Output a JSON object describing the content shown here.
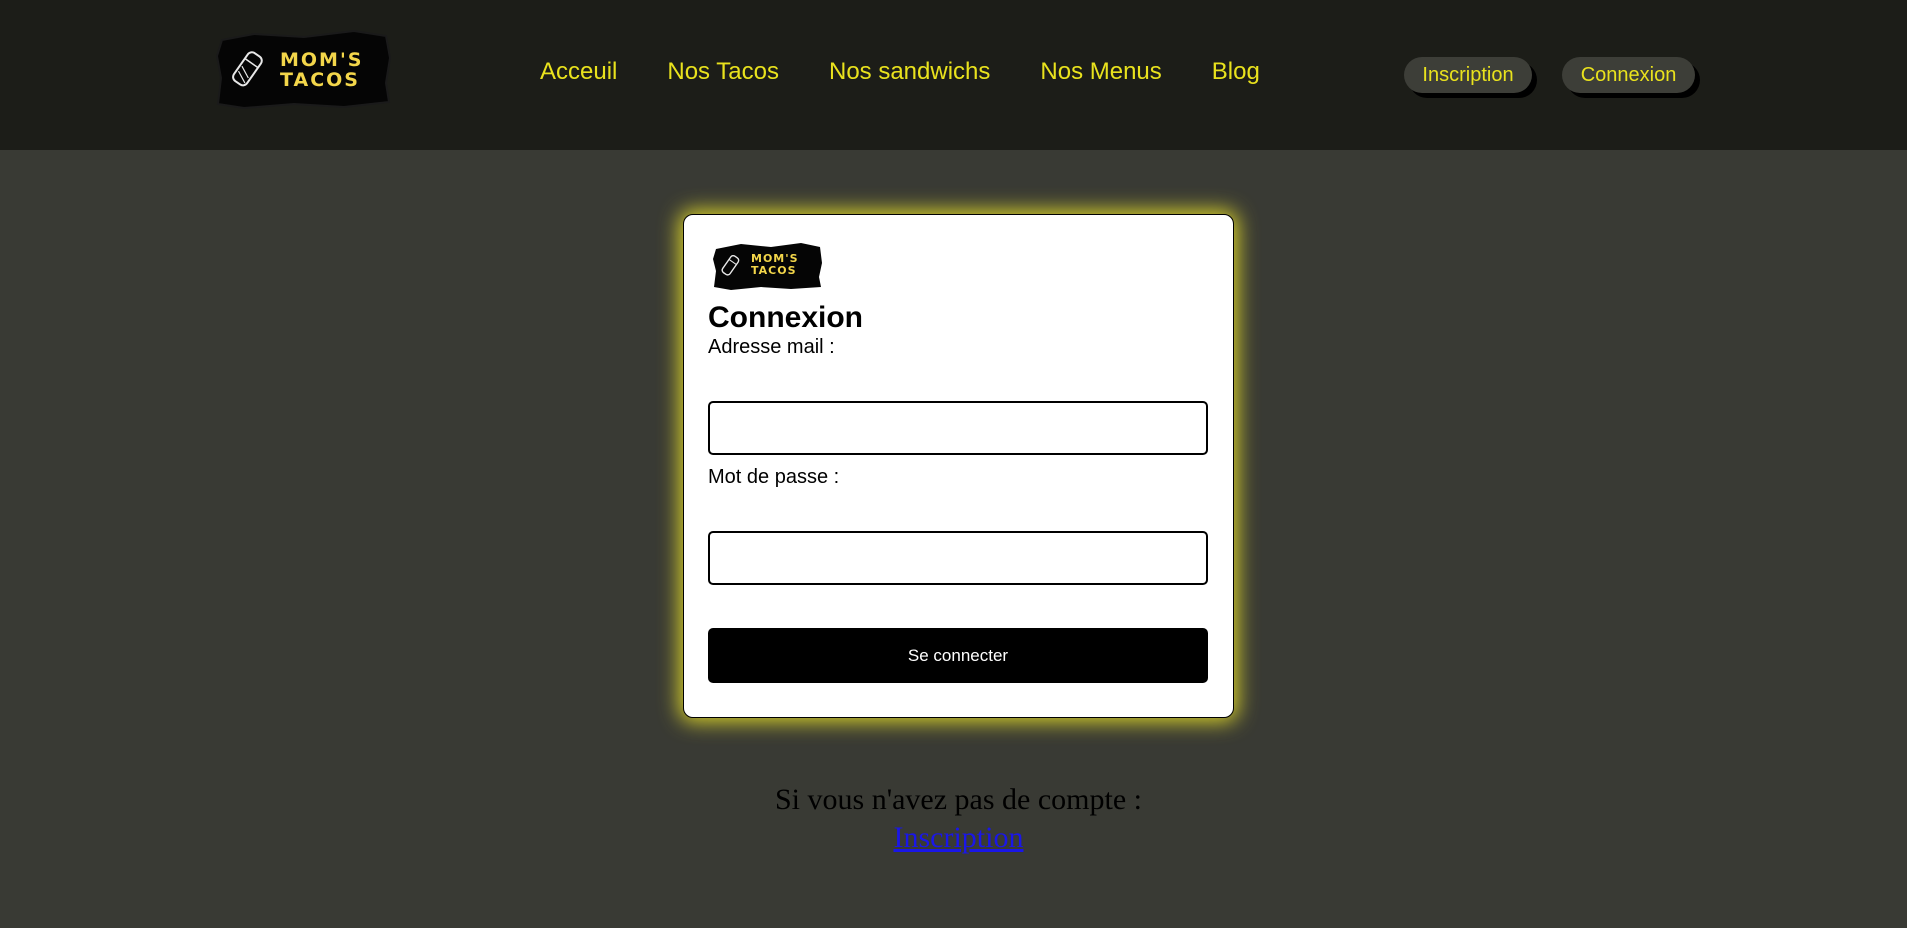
{
  "brand": {
    "logo_line1": "MOM'S",
    "logo_line2": "TACOS"
  },
  "nav": {
    "items": [
      {
        "label": "Acceuil"
      },
      {
        "label": "Nos Tacos"
      },
      {
        "label": "Nos sandwichs"
      },
      {
        "label": "Nos Menus"
      },
      {
        "label": "Blog"
      }
    ]
  },
  "header_buttons": {
    "inscription": "Inscription",
    "connexion": "Connexion"
  },
  "form": {
    "title": "Connexion",
    "email_label": "Adresse mail :",
    "email_value": "",
    "password_label": "Mot de passe :",
    "password_value": "",
    "submit_label": "Se connecter"
  },
  "signup": {
    "prompt": "Si vous n'avez pas de compte :",
    "link_label": "Inscription"
  },
  "colors": {
    "header_bg": "#1c1d18",
    "page_bg": "#393a34",
    "accent": "#e9e21d",
    "logo_text": "#f3d64a",
    "card_glow": "#d7d02a",
    "link": "#1a16e8"
  }
}
